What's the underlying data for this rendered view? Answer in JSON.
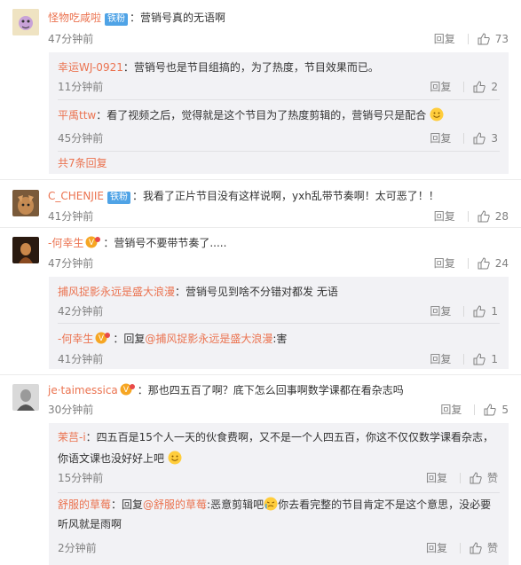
{
  "comments": [
    {
      "name": "怪物吃咸啦",
      "badge": "铁粉",
      "text": "：营销号真的无语啊",
      "time": "47分钟前",
      "reply": "回复",
      "likes": "73",
      "replies": [
        {
          "name": "幸运WJ-0921",
          "text": "：营销号也是节目组搞的，为了热度，节目效果而已。",
          "time": "11分钟前",
          "reply": "回复",
          "likes": "2"
        },
        {
          "name": "平禹ttw",
          "text": "：看了视频之后，觉得就是这个节目为了热度剪辑的，营销号只是配合",
          "time": "45分钟前",
          "reply": "回复",
          "likes": "3"
        }
      ],
      "more": "共7条回复"
    },
    {
      "name": "C_CHENJIE",
      "badge": "铁粉",
      "text": "：我看了正片节目没有这样说啊，yxh乱带节奏啊！太可恶了！！",
      "time": "41分钟前",
      "reply": "回复",
      "likes": "28"
    },
    {
      "name": "-何幸生",
      "text": "：营销号不要带节奏了.....",
      "time": "47分钟前",
      "reply": "回复",
      "likes": "24",
      "replies": [
        {
          "name": "捕风捉影永远是盛大浪漫",
          "text": "：营销号见到啥不分错对都发 无语",
          "time": "42分钟前",
          "reply": "回复",
          "likes": "1"
        },
        {
          "name": "-何幸生",
          "text_prefix": "：回复",
          "mention": "@捕风捉影永远是盛大浪漫",
          "text": ":害",
          "time": "41分钟前",
          "reply": "回复",
          "likes": "1"
        }
      ]
    },
    {
      "name": "je·taimessica",
      "text": "：那也四五百了啊？底下怎么回事啊数学课都在看杂志吗",
      "time": "30分钟前",
      "reply": "回复",
      "likes": "5",
      "replies": [
        {
          "name": "茉莒-i",
          "text1": "：四五百是15个人一天的伙食费啊，又不是一个人四五百，你这不仅仅数学课看杂志，",
          "text2": "你语文课也没好好上吧",
          "time": "15分钟前",
          "reply": "回复",
          "likes": "赞"
        },
        {
          "name": "舒服的草莓",
          "text_prefix": "：回复",
          "mention": "@舒服的草莓",
          "text1": ":恶意剪辑吧",
          "text1b": "你去看完整的节目肯定不是这个意思，没必要",
          "text2": "听风就是雨啊",
          "time": "2分钟前",
          "reply": "回复",
          "likes": "赞"
        }
      ]
    }
  ]
}
